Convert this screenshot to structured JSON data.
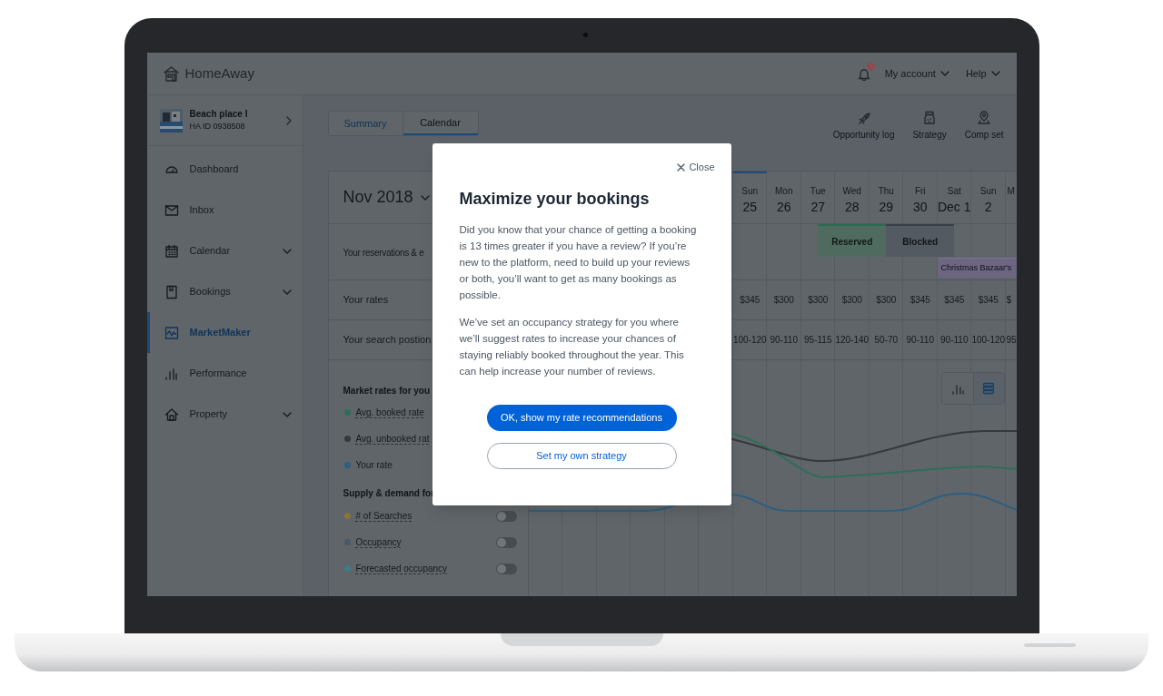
{
  "header": {
    "logo": "HomeAway",
    "notifications": {
      "unread": true
    },
    "account_menu": "My account",
    "help_menu": "Help"
  },
  "property": {
    "name": "Beach place I",
    "id": "HA ID 0938508"
  },
  "sidebar": {
    "items": [
      {
        "label": "Dashboard",
        "selected": false,
        "expandable": false
      },
      {
        "label": "Inbox",
        "selected": false,
        "expandable": false
      },
      {
        "label": "Calendar",
        "selected": false,
        "expandable": true
      },
      {
        "label": "Bookings",
        "selected": false,
        "expandable": true
      },
      {
        "label": "MarketMaker",
        "selected": true,
        "expandable": false
      },
      {
        "label": "Performance",
        "selected": false,
        "expandable": false
      },
      {
        "label": "Property",
        "selected": false,
        "expandable": true
      }
    ]
  },
  "tabs": [
    {
      "label": "Summary",
      "selected": false
    },
    {
      "label": "Calendar",
      "selected": true
    }
  ],
  "tools": [
    {
      "label": "Opportunity log"
    },
    {
      "label": "Strategy"
    },
    {
      "label": "Comp set"
    }
  ],
  "calendar": {
    "month": "Nov 2018",
    "row_labels": [
      "Your reservations & e",
      "Your rates",
      "Your search postion"
    ],
    "days": [
      {
        "weekday": "Sun",
        "date": "25",
        "today": true
      },
      {
        "weekday": "Mon",
        "date": "26",
        "today": false
      },
      {
        "weekday": "Tue",
        "date": "27",
        "today": false
      },
      {
        "weekday": "Wed",
        "date": "28",
        "today": false
      },
      {
        "weekday": "Thu",
        "date": "29",
        "today": false
      },
      {
        "weekday": "Fri",
        "date": "30",
        "today": false
      },
      {
        "weekday": "Sat",
        "date": "Dec 1",
        "today": false
      },
      {
        "weekday": "Sun",
        "date": "2",
        "today": false
      },
      {
        "weekday": "M",
        "today": false
      }
    ],
    "bookings": [
      {
        "label": "Reserved",
        "kind": "reserved"
      },
      {
        "label": "Blocked",
        "kind": "blocked"
      }
    ],
    "events": [
      {
        "label": "Christmas Bazaar's"
      }
    ],
    "rates": [
      "$345",
      "$300",
      "$300",
      "$300",
      "$300",
      "$345",
      "$345",
      "$345",
      "$"
    ],
    "search_positions": [
      "100-120",
      "90-110",
      "95-115",
      "120-140",
      "50-70",
      "90-110",
      "90-110",
      "100-120",
      "95"
    ],
    "chart_views": [
      {
        "selected": false
      },
      {
        "selected": true
      }
    ]
  },
  "market_rates": {
    "title": "Market rates for you",
    "items": [
      {
        "label": "Avg. booked rate",
        "color": "#2e6e58",
        "has_tooltip": true
      },
      {
        "label": "Avg. unbooked rat",
        "color": "#35393e",
        "has_tooltip": true
      },
      {
        "label": "Your rate",
        "color": "#2d5f80",
        "has_tooltip": false
      }
    ]
  },
  "supply_demand": {
    "title": "Supply & demand for",
    "items": [
      {
        "label": "# of Searches",
        "color": "#8a7438",
        "on": false
      },
      {
        "label": "Occupancy",
        "color": "#4a5867",
        "on": false
      },
      {
        "label": "Forecasted occupancy",
        "color": "#3f7a88",
        "on": false
      }
    ]
  },
  "modal": {
    "close": "Close",
    "title": "Maximize your bookings",
    "paragraphs": [
      "Did you know that your chance of getting a booking is 13 times greater if you have a review? If you’re new to the platform, need to build up your reviews or both, you’ll want to get as many bookings as possible.",
      "We’ve set an occupancy strategy for you where we’ll suggest rates to increase your chances of staying reliably booked throughout the year. This can help increase your number of reviews."
    ],
    "buttons": [
      {
        "label": "OK, show my rate recommendations",
        "kind": "primary"
      },
      {
        "label": "Set my own strategy",
        "kind": "secondary"
      }
    ]
  }
}
